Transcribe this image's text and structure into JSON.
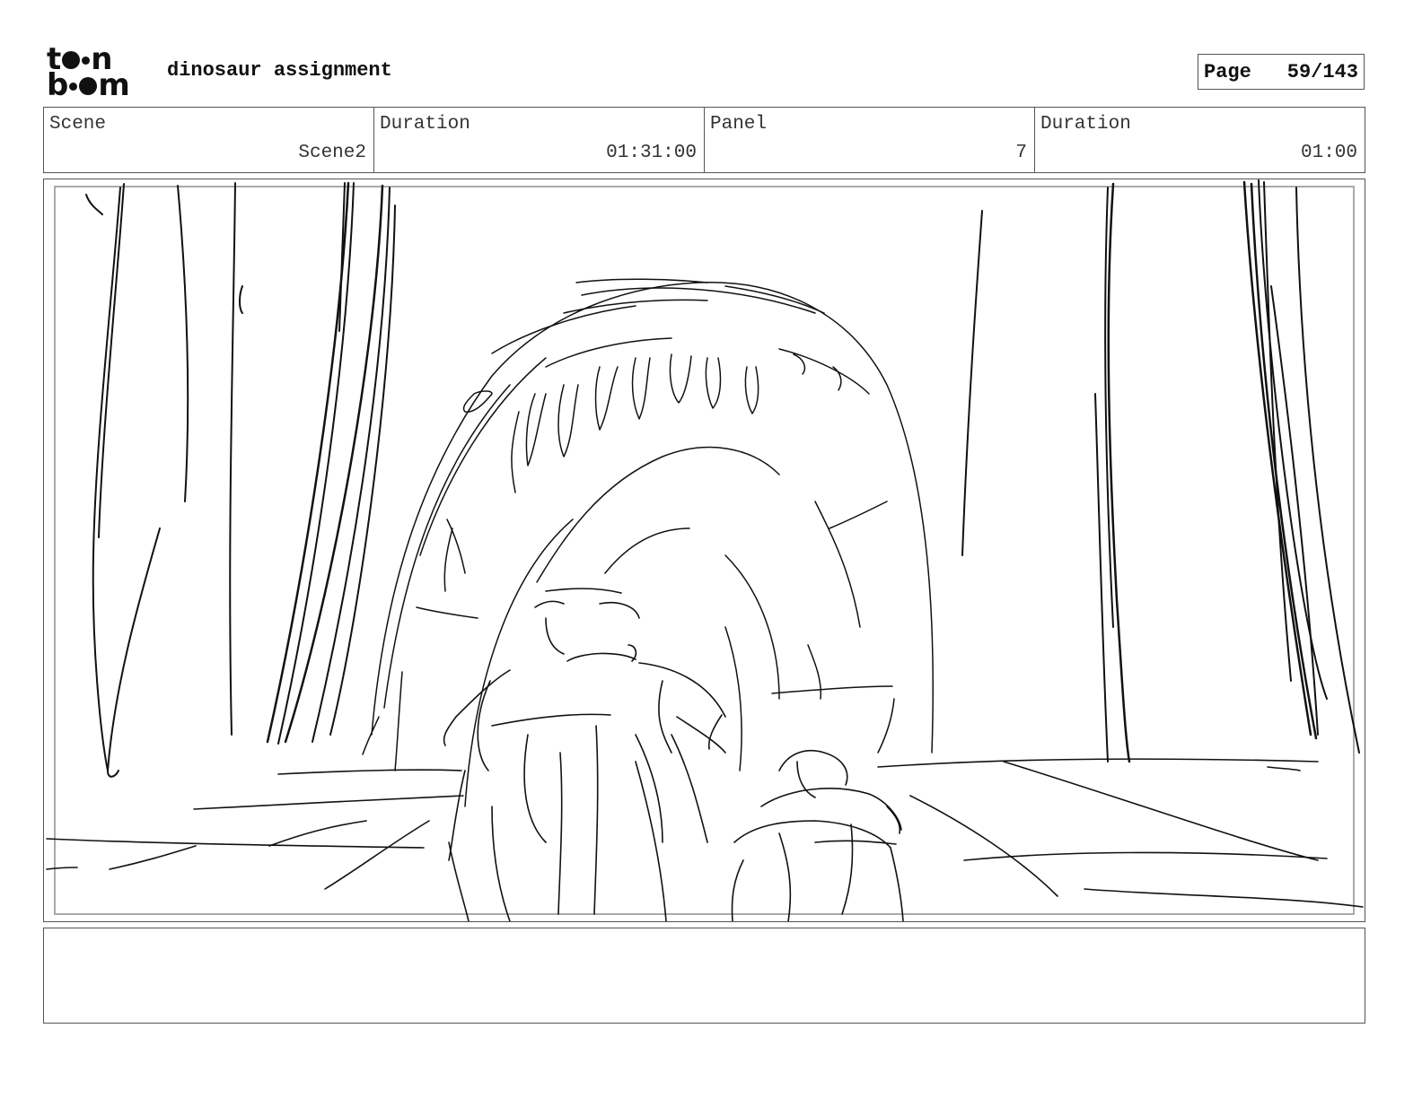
{
  "logo": {
    "line1": [
      "t",
      "o",
      "n"
    ],
    "line2": [
      "b",
      "o",
      "m"
    ],
    "alt": "toon boom"
  },
  "header": {
    "project_title": "dinosaur assignment",
    "page_label": "Page",
    "page_value": "59/143"
  },
  "info": [
    {
      "label": "Scene",
      "value": "Scene2"
    },
    {
      "label": "Duration",
      "value": "01:31:00"
    },
    {
      "label": "Panel",
      "value": "7"
    },
    {
      "label": "Duration",
      "value": "01:00"
    }
  ],
  "panel": {
    "image": "storyboard-sketch"
  },
  "notes": {
    "text": ""
  }
}
